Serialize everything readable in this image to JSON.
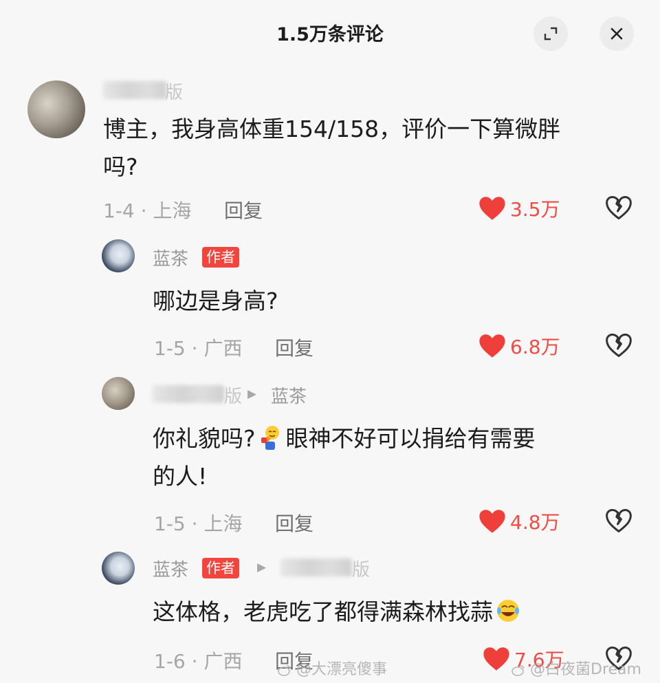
{
  "header": {
    "title": "1.5万条评论"
  },
  "comments": [
    {
      "username_tail": "版",
      "text_line1": "博主，我身高体重154/158，评价一下算微胖",
      "text_line2": "吗?",
      "date": "1-4",
      "location": "上海",
      "reply_label": "回复",
      "likes": "3.5万"
    },
    {
      "username": "蓝茶",
      "badge": "作者",
      "text_line1": "哪边是身高?",
      "date": "1-5",
      "location": "广西",
      "reply_label": "回复",
      "likes": "6.8万"
    },
    {
      "username_tail": "版",
      "reply_to": "蓝茶",
      "text_line1_a": "你礼貌吗?",
      "text_line1_b": "眼神不好可以捐给有需要",
      "text_line2": "的人!",
      "date": "1-5",
      "location": "上海",
      "reply_label": "回复",
      "likes": "4.8万"
    },
    {
      "username": "蓝茶",
      "badge": "作者",
      "username_tail": "版",
      "text_line1": "这体格，老虎吃了都得满森林找蒜",
      "date": "1-6",
      "location": "广西",
      "reply_label": "回复",
      "likes": "7.6万"
    }
  ],
  "meta_separator": "·",
  "watermarks": [
    "@大漂亮傻事",
    "@白夜菌Dream"
  ],
  "colors": {
    "like_red": "#f04c43",
    "badge_red": "#f2453d",
    "meta_gray": "#a5a5a5"
  },
  "icons": [
    "expand-icon",
    "close-icon",
    "heart-icon",
    "broken-heart-icon",
    "emoji-facepalm-icon",
    "emoji-laughing-icon",
    "weibo-icon"
  ]
}
